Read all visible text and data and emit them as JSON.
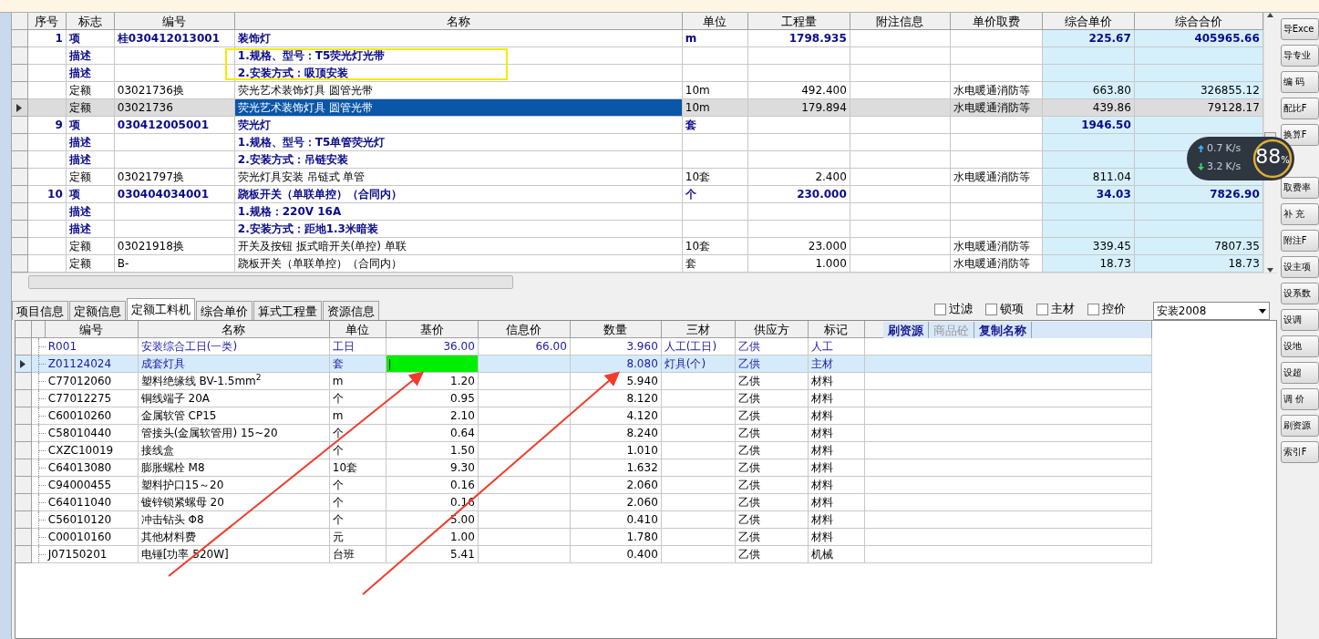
{
  "upper_table": {
    "columns": [
      "序号",
      "标志",
      "编号",
      "名称",
      "单位",
      "工程量",
      "附注信息",
      "单价取费",
      "综合单价",
      "综合合价"
    ],
    "rows": [
      {
        "kind": "item",
        "selected": false,
        "seq": "1",
        "flag": "项",
        "code": "桂030412013001",
        "name": "装饰灯",
        "unit": "m",
        "qty": "1798.935",
        "fee": "",
        "price": "225.67",
        "total": "405965.66"
      },
      {
        "kind": "desc",
        "selected": false,
        "seq": "",
        "flag": "描述",
        "code": "",
        "name": "1.规格、型号：T5荧光灯光带",
        "unit": "",
        "qty": "",
        "fee": "",
        "price": "",
        "total": ""
      },
      {
        "kind": "desc",
        "selected": false,
        "seq": "",
        "flag": "描述",
        "code": "",
        "name": "2.安装方式：吸顶安装",
        "unit": "",
        "qty": "",
        "fee": "",
        "price": "",
        "total": ""
      },
      {
        "kind": "quota",
        "selected": false,
        "seq": "",
        "flag": "定额",
        "code": "03021736换",
        "name": "荧光艺术装饰灯具 圆管光带",
        "unit": "10m",
        "qty": "492.400",
        "fee": "水电暖通消防等",
        "price": "663.80",
        "total": "326855.12"
      },
      {
        "kind": "quota",
        "selected": true,
        "seq": "",
        "flag": "定额",
        "code": "03021736",
        "name": "荧光艺术装饰灯具 圆管光带",
        "unit": "10m",
        "qty": "179.894",
        "fee": "水电暖通消防等",
        "price": "439.86",
        "total": "79128.17"
      },
      {
        "kind": "item",
        "selected": false,
        "seq": "9",
        "flag": "项",
        "code": "030412005001",
        "name": "荧光灯",
        "unit": "套",
        "qty": "",
        "fee": "",
        "price": "1946.50",
        "total": ""
      },
      {
        "kind": "desc",
        "selected": false,
        "seq": "",
        "flag": "描述",
        "code": "",
        "name": "1.规格、型号：T5单管荧光灯",
        "unit": "",
        "qty": "",
        "fee": "",
        "price": "",
        "total": ""
      },
      {
        "kind": "desc",
        "selected": false,
        "seq": "",
        "flag": "描述",
        "code": "",
        "name": "2.安装方式：吊链安装",
        "unit": "",
        "qty": "",
        "fee": "",
        "price": "",
        "total": ""
      },
      {
        "kind": "quota",
        "selected": false,
        "seq": "",
        "flag": "定额",
        "code": "03021797换",
        "name": "荧光灯具安装 吊链式 单管",
        "unit": "10套",
        "qty": "2.400",
        "fee": "水电暖通消防等",
        "price": "811.04",
        "total": ""
      },
      {
        "kind": "item",
        "selected": false,
        "seq": "10",
        "flag": "项",
        "code": "030404034001",
        "name": "跷板开关（单联单控）（合同内）",
        "unit": "个",
        "qty": "230.000",
        "fee": "",
        "price": "34.03",
        "total": "7826.90"
      },
      {
        "kind": "desc",
        "selected": false,
        "seq": "",
        "flag": "描述",
        "code": "",
        "name": "1.规格：220V 16A",
        "unit": "",
        "qty": "",
        "fee": "",
        "price": "",
        "total": ""
      },
      {
        "kind": "desc",
        "selected": false,
        "seq": "",
        "flag": "描述",
        "code": "",
        "name": "2.安装方式：距地1.3米暗装",
        "unit": "",
        "qty": "",
        "fee": "",
        "price": "",
        "total": ""
      },
      {
        "kind": "quota",
        "selected": false,
        "seq": "",
        "flag": "定额",
        "code": "03021918换",
        "name": "开关及按钮 扳式暗开关(单控) 单联",
        "unit": "10套",
        "qty": "23.000",
        "fee": "水电暖通消防等",
        "price": "339.45",
        "total": "7807.35"
      },
      {
        "kind": "quota",
        "selected": false,
        "seq": "",
        "flag": "定额",
        "code": "B-",
        "name": "跷板开关（单联单控）（合同内）",
        "unit": "套",
        "qty": "1.000",
        "fee": "水电暖通消防等",
        "price": "18.73",
        "total": "18.73"
      }
    ]
  },
  "lower_tabs": [
    {
      "label": "项目信息",
      "selected": false
    },
    {
      "label": "定额信息",
      "selected": false
    },
    {
      "label": "定额工料机",
      "selected": true
    },
    {
      "label": "综合单价",
      "selected": false
    },
    {
      "label": "算式工程量",
      "selected": false
    },
    {
      "label": "资源信息",
      "selected": false
    }
  ],
  "filters": [
    {
      "label": "过滤",
      "checked": false
    },
    {
      "label": "锁项",
      "checked": false
    },
    {
      "label": "主材",
      "checked": false
    },
    {
      "label": "控价",
      "checked": false
    }
  ],
  "library_select": {
    "value": "安装2008"
  },
  "lower_table": {
    "columns": [
      "编号",
      "名称",
      "单位",
      "基价",
      "信息价",
      "数量",
      "三材",
      "供应方",
      "标记"
    ],
    "header_buttons": [
      {
        "label": "刷资源",
        "disabled": false
      },
      {
        "label": "商品砼",
        "disabled": true
      },
      {
        "label": "复制名称",
        "disabled": false
      }
    ],
    "rows": [
      {
        "emphasized": true,
        "selected": false,
        "editing": false,
        "code": "R001",
        "name": "安装综合工日(一类)",
        "unit": "工日",
        "base": "36.00",
        "info": "66.00",
        "qty": "3.960",
        "material": "人工(工日)",
        "supplier": "乙供",
        "mark": "人工"
      },
      {
        "emphasized": true,
        "selected": true,
        "editing": true,
        "code": "Z01124024",
        "name": "成套灯具",
        "unit": "套",
        "base": "",
        "info": "",
        "qty": "8.080",
        "material": "灯具(个)",
        "supplier": "乙供",
        "mark": "主材"
      },
      {
        "emphasized": false,
        "selected": false,
        "editing": false,
        "code": "C77012060",
        "name": "塑料绝缘线 BV-1.5mm$^{2}$",
        "unit": "m",
        "base": "1.20",
        "info": "",
        "qty": "5.940",
        "material": "",
        "supplier": "乙供",
        "mark": "材料"
      },
      {
        "emphasized": false,
        "selected": false,
        "editing": false,
        "code": "C77012275",
        "name": "铜线端子 20A",
        "unit": "个",
        "base": "0.95",
        "info": "",
        "qty": "8.120",
        "material": "",
        "supplier": "乙供",
        "mark": "材料"
      },
      {
        "emphasized": false,
        "selected": false,
        "editing": false,
        "code": "C60010260",
        "name": "金属软管 CP15",
        "unit": "m",
        "base": "2.10",
        "info": "",
        "qty": "4.120",
        "material": "",
        "supplier": "乙供",
        "mark": "材料"
      },
      {
        "emphasized": false,
        "selected": false,
        "editing": false,
        "code": "C58010440",
        "name": "管接头(金属软管用) 15~20",
        "unit": "个",
        "base": "0.64",
        "info": "",
        "qty": "8.240",
        "material": "",
        "supplier": "乙供",
        "mark": "材料"
      },
      {
        "emphasized": false,
        "selected": false,
        "editing": false,
        "code": "CXZC10019",
        "name": "接线盒",
        "unit": "个",
        "base": "1.50",
        "info": "",
        "qty": "1.010",
        "material": "",
        "supplier": "乙供",
        "mark": "材料"
      },
      {
        "emphasized": false,
        "selected": false,
        "editing": false,
        "code": "C64013080",
        "name": "膨胀螺栓 M8",
        "unit": "10套",
        "base": "9.30",
        "info": "",
        "qty": "1.632",
        "material": "",
        "supplier": "乙供",
        "mark": "材料"
      },
      {
        "emphasized": false,
        "selected": false,
        "editing": false,
        "code": "C94000455",
        "name": "塑料护口15～20",
        "unit": "个",
        "base": "0.16",
        "info": "",
        "qty": "2.060",
        "material": "",
        "supplier": "乙供",
        "mark": "材料"
      },
      {
        "emphasized": false,
        "selected": false,
        "editing": false,
        "code": "C64011040",
        "name": "镀锌锁紧螺母 20",
        "unit": "个",
        "base": "0.16",
        "info": "",
        "qty": "2.060",
        "material": "",
        "supplier": "乙供",
        "mark": "材料"
      },
      {
        "emphasized": false,
        "selected": false,
        "editing": false,
        "code": "C56010120",
        "name": "冲击钻头 Φ8",
        "unit": "个",
        "base": "5.00",
        "info": "",
        "qty": "0.410",
        "material": "",
        "supplier": "乙供",
        "mark": "材料"
      },
      {
        "emphasized": false,
        "selected": false,
        "editing": false,
        "code": "C00010160",
        "name": "其他材料费",
        "unit": "元",
        "base": "1.00",
        "info": "",
        "qty": "1.780",
        "material": "",
        "supplier": "乙供",
        "mark": "材料"
      },
      {
        "emphasized": false,
        "selected": false,
        "editing": false,
        "code": "J07150201",
        "name": "电锤[功率 520W]",
        "unit": "台班",
        "base": "5.41",
        "info": "",
        "qty": "0.400",
        "material": "",
        "supplier": "乙供",
        "mark": "机械"
      }
    ]
  },
  "side_buttons": [
    "导Exce",
    "导专业",
    "编 码",
    "配比F",
    "换算F",
    "取费率",
    "补 充",
    "附注F",
    "设主项",
    "设系数",
    "设调",
    "设地",
    "设超",
    "调 价",
    "刷资源",
    "索引F"
  ],
  "speed_widget": {
    "upload": "0.7",
    "upload_unit": "K/s",
    "download": "3.2",
    "download_unit": "K/s",
    "percent": "88",
    "percent_sign": "%"
  }
}
